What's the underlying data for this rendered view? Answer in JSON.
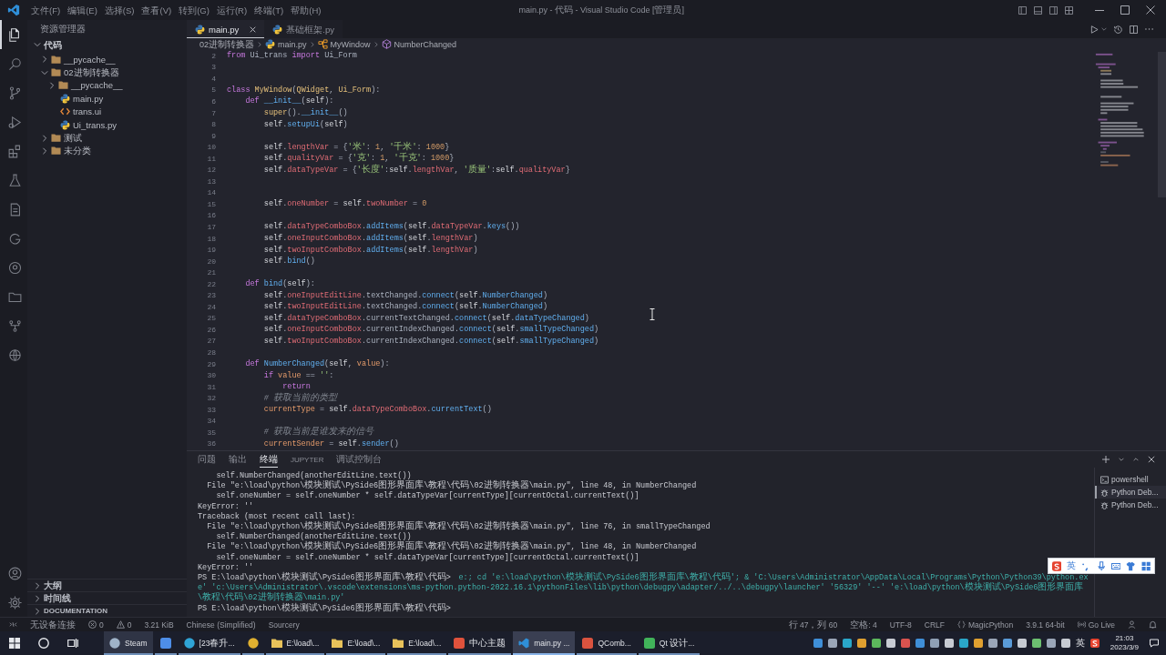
{
  "title_bar": {
    "menus": [
      "文件(F)",
      "编辑(E)",
      "选择(S)",
      "查看(V)",
      "转到(G)",
      "运行(R)",
      "终端(T)",
      "帮助(H)"
    ],
    "title": "main.py - 代码 - Visual Studio Code [管理员]"
  },
  "activity_bar": {
    "items": [
      {
        "kind": "files",
        "selected": true
      },
      {
        "kind": "search",
        "selected": false
      },
      {
        "kind": "scm",
        "selected": false
      },
      {
        "kind": "debug",
        "selected": false
      },
      {
        "kind": "extensions",
        "selected": false
      },
      {
        "kind": "testing",
        "selected": false
      },
      {
        "kind": "pages",
        "selected": false
      },
      {
        "kind": "ring",
        "selected": false
      },
      {
        "kind": "circle",
        "selected": false
      },
      {
        "kind": "folder",
        "selected": false
      },
      {
        "kind": "tree",
        "selected": false
      },
      {
        "kind": "globe",
        "selected": false
      }
    ],
    "bottom": [
      {
        "kind": "account"
      },
      {
        "kind": "settings"
      }
    ]
  },
  "sidebar": {
    "title": "资源管理器",
    "tree": [
      {
        "label": "代码",
        "kind": "root",
        "expanded": true,
        "children": [
          {
            "label": "__pycache__",
            "kind": "folder",
            "expanded": false
          },
          {
            "label": "02进制转换器",
            "kind": "folder",
            "expanded": true,
            "children": [
              {
                "label": "__pycache__",
                "kind": "folder",
                "expanded": false
              },
              {
                "label": "main.py",
                "kind": "python"
              },
              {
                "label": "trans.ui",
                "kind": "ui"
              },
              {
                "label": "Ui_trans.py",
                "kind": "python"
              }
            ]
          },
          {
            "label": "测试",
            "kind": "folder",
            "expanded": false
          },
          {
            "label": "未分类",
            "kind": "folder",
            "expanded": false
          }
        ]
      }
    ],
    "sections": [
      {
        "label": "大纲",
        "expanded": false
      },
      {
        "label": "时间线",
        "expanded": false
      },
      {
        "label": "DOCUMENTATION",
        "expanded": false
      }
    ]
  },
  "editor": {
    "tabs": [
      {
        "label": "main.py",
        "kind": "python",
        "selected": true
      },
      {
        "label": "基础框架.py",
        "kind": "python",
        "selected": false
      }
    ],
    "breadcrumb": [
      {
        "label": "02进制转换器",
        "kind": "folder"
      },
      {
        "label": "main.py",
        "kind": "python"
      },
      {
        "label": "MyWindow",
        "kind": "class"
      },
      {
        "label": "NumberChanged",
        "kind": "method"
      }
    ],
    "lines": [
      {
        "number": "2",
        "tokens": [
          {
            "kind": "kw",
            "text": "from"
          },
          {
            "kind": "txt",
            "text": " Ui_trans "
          },
          {
            "kind": "kw",
            "text": "import"
          },
          {
            "kind": "txt",
            "text": " Ui_Form"
          }
        ]
      },
      {
        "number": "3"
      },
      {
        "number": "4"
      },
      {
        "number": "5",
        "tokens": [
          {
            "kind": "kw",
            "text": "class "
          },
          {
            "kind": "cls",
            "text": "MyWindow"
          },
          {
            "kind": "txt",
            "text": "("
          },
          {
            "kind": "cls",
            "text": "QWidget"
          },
          {
            "kind": "txt",
            "text": ", "
          },
          {
            "kind": "cls",
            "text": "Ui_Form"
          },
          {
            "kind": "txt",
            "text": "):"
          }
        ],
        "children": [
          {
            "number": "6",
            "tokens": [
              {
                "kind": "kw",
                "text": "def "
              },
              {
                "kind": "fn",
                "text": "__init__"
              },
              {
                "kind": "txt",
                "text": "("
              },
              {
                "kind": "self",
                "text": "self"
              },
              {
                "kind": "txt",
                "text": "):"
              }
            ],
            "children": [
              {
                "number": "7",
                "tokens": [
                  {
                    "kind": "cls",
                    "text": "super"
                  },
                  {
                    "kind": "txt",
                    "text": "()."
                  },
                  {
                    "kind": "fn",
                    "text": "__init__"
                  },
                  {
                    "kind": "txt",
                    "text": "()"
                  }
                ]
              },
              {
                "number": "8",
                "tokens": [
                  {
                    "kind": "self",
                    "text": "self"
                  },
                  {
                    "kind": "txt",
                    "text": "."
                  },
                  {
                    "kind": "fn",
                    "text": "setupUi"
                  },
                  {
                    "kind": "txt",
                    "text": "("
                  },
                  {
                    "kind": "self",
                    "text": "self"
                  },
                  {
                    "kind": "txt",
                    "text": ")"
                  }
                ]
              },
              {
                "number": "9"
              },
              {
                "number": "10",
                "tokens": [
                  {
                    "kind": "self",
                    "text": "self"
                  },
                  {
                    "kind": "txt",
                    "text": "."
                  },
                  {
                    "kind": "attr",
                    "text": "lengthVar"
                  },
                  {
                    "kind": "txt",
                    "text": " = {"
                  },
                  {
                    "kind": "str",
                    "text": "'米'"
                  },
                  {
                    "kind": "txt",
                    "text": ": "
                  },
                  {
                    "kind": "num",
                    "text": "1"
                  },
                  {
                    "kind": "txt",
                    "text": ", "
                  },
                  {
                    "kind": "str",
                    "text": "'千米'"
                  },
                  {
                    "kind": "txt",
                    "text": ": "
                  },
                  {
                    "kind": "num",
                    "text": "1000"
                  },
                  {
                    "kind": "txt",
                    "text": "}"
                  }
                ]
              },
              {
                "number": "11",
                "tokens": [
                  {
                    "kind": "self",
                    "text": "self"
                  },
                  {
                    "kind": "txt",
                    "text": "."
                  },
                  {
                    "kind": "attr",
                    "text": "qualityVar"
                  },
                  {
                    "kind": "txt",
                    "text": " = {"
                  },
                  {
                    "kind": "str",
                    "text": "'克'"
                  },
                  {
                    "kind": "txt",
                    "text": ": "
                  },
                  {
                    "kind": "num",
                    "text": "1"
                  },
                  {
                    "kind": "txt",
                    "text": ", "
                  },
                  {
                    "kind": "str",
                    "text": "'千克'"
                  },
                  {
                    "kind": "txt",
                    "text": ": "
                  },
                  {
                    "kind": "num",
                    "text": "1000"
                  },
                  {
                    "kind": "txt",
                    "text": "}"
                  }
                ]
              },
              {
                "number": "12",
                "tokens": [
                  {
                    "kind": "self",
                    "text": "self"
                  },
                  {
                    "kind": "txt",
                    "text": "."
                  },
                  {
                    "kind": "attr",
                    "text": "dataTypeVar"
                  },
                  {
                    "kind": "txt",
                    "text": " = {"
                  },
                  {
                    "kind": "str",
                    "text": "'长度'"
                  },
                  {
                    "kind": "txt",
                    "text": ":"
                  },
                  {
                    "kind": "self",
                    "text": "self"
                  },
                  {
                    "kind": "txt",
                    "text": "."
                  },
                  {
                    "kind": "attr",
                    "text": "lengthVar"
                  },
                  {
                    "kind": "txt",
                    "text": ", "
                  },
                  {
                    "kind": "str",
                    "text": "'质量'"
                  },
                  {
                    "kind": "txt",
                    "text": ":"
                  },
                  {
                    "kind": "self",
                    "text": "self"
                  },
                  {
                    "kind": "txt",
                    "text": "."
                  },
                  {
                    "kind": "attr",
                    "text": "qualityVar"
                  },
                  {
                    "kind": "txt",
                    "text": "}"
                  }
                ]
              },
              {
                "number": "13"
              },
              {
                "number": "14"
              },
              {
                "number": "15",
                "tokens": [
                  {
                    "kind": "self",
                    "text": "self"
                  },
                  {
                    "kind": "txt",
                    "text": "."
                  },
                  {
                    "kind": "attr",
                    "text": "oneNumber"
                  },
                  {
                    "kind": "txt",
                    "text": " = "
                  },
                  {
                    "kind": "self",
                    "text": "self"
                  },
                  {
                    "kind": "txt",
                    "text": "."
                  },
                  {
                    "kind": "attr",
                    "text": "twoNumber"
                  },
                  {
                    "kind": "txt",
                    "text": " = "
                  },
                  {
                    "kind": "num",
                    "text": "0"
                  }
                ]
              },
              {
                "number": "16"
              },
              {
                "number": "17",
                "tokens": [
                  {
                    "kind": "self",
                    "text": "self"
                  },
                  {
                    "kind": "txt",
                    "text": "."
                  },
                  {
                    "kind": "attr",
                    "text": "dataTypeComboBox"
                  },
                  {
                    "kind": "txt",
                    "text": "."
                  },
                  {
                    "kind": "fn",
                    "text": "addItems"
                  },
                  {
                    "kind": "txt",
                    "text": "("
                  },
                  {
                    "kind": "self",
                    "text": "self"
                  },
                  {
                    "kind": "txt",
                    "text": "."
                  },
                  {
                    "kind": "attr",
                    "text": "dataTypeVar"
                  },
                  {
                    "kind": "txt",
                    "text": "."
                  },
                  {
                    "kind": "fn",
                    "text": "keys"
                  },
                  {
                    "kind": "txt",
                    "text": "())"
                  }
                ]
              },
              {
                "number": "18",
                "tokens": [
                  {
                    "kind": "self",
                    "text": "self"
                  },
                  {
                    "kind": "txt",
                    "text": "."
                  },
                  {
                    "kind": "attr",
                    "text": "oneInputComboBox"
                  },
                  {
                    "kind": "txt",
                    "text": "."
                  },
                  {
                    "kind": "fn",
                    "text": "addItems"
                  },
                  {
                    "kind": "txt",
                    "text": "("
                  },
                  {
                    "kind": "self",
                    "text": "self"
                  },
                  {
                    "kind": "txt",
                    "text": "."
                  },
                  {
                    "kind": "attr",
                    "text": "lengthVar"
                  },
                  {
                    "kind": "txt",
                    "text": ")"
                  }
                ]
              },
              {
                "number": "19",
                "tokens": [
                  {
                    "kind": "self",
                    "text": "self"
                  },
                  {
                    "kind": "txt",
                    "text": "."
                  },
                  {
                    "kind": "attr",
                    "text": "twoInputComboBox"
                  },
                  {
                    "kind": "txt",
                    "text": "."
                  },
                  {
                    "kind": "fn",
                    "text": "addItems"
                  },
                  {
                    "kind": "txt",
                    "text": "("
                  },
                  {
                    "kind": "self",
                    "text": "self"
                  },
                  {
                    "kind": "txt",
                    "text": "."
                  },
                  {
                    "kind": "attr",
                    "text": "lengthVar"
                  },
                  {
                    "kind": "txt",
                    "text": ")"
                  }
                ]
              },
              {
                "number": "20",
                "tokens": [
                  {
                    "kind": "self",
                    "text": "self"
                  },
                  {
                    "kind": "txt",
                    "text": "."
                  },
                  {
                    "kind": "fn",
                    "text": "bind"
                  },
                  {
                    "kind": "txt",
                    "text": "()"
                  }
                ]
              },
              {
                "number": "21"
              }
            ]
          },
          {
            "number": "22",
            "tokens": [
              {
                "kind": "kw",
                "text": "def "
              },
              {
                "kind": "fn",
                "text": "bind"
              },
              {
                "kind": "txt",
                "text": "("
              },
              {
                "kind": "self",
                "text": "self"
              },
              {
                "kind": "txt",
                "text": "):"
              }
            ],
            "children": [
              {
                "number": "23",
                "tokens": [
                  {
                    "kind": "self",
                    "text": "self"
                  },
                  {
                    "kind": "txt",
                    "text": "."
                  },
                  {
                    "kind": "attr",
                    "text": "oneInputEditLine"
                  },
                  {
                    "kind": "txt",
                    "text": ".textChanged."
                  },
                  {
                    "kind": "fn",
                    "text": "connect"
                  },
                  {
                    "kind": "txt",
                    "text": "("
                  },
                  {
                    "kind": "self",
                    "text": "self"
                  },
                  {
                    "kind": "txt",
                    "text": "."
                  },
                  {
                    "kind": "fn",
                    "text": "NumberChanged"
                  },
                  {
                    "kind": "txt",
                    "text": ")"
                  }
                ]
              },
              {
                "number": "24",
                "tokens": [
                  {
                    "kind": "self",
                    "text": "self"
                  },
                  {
                    "kind": "txt",
                    "text": "."
                  },
                  {
                    "kind": "attr",
                    "text": "twoInputEditLine"
                  },
                  {
                    "kind": "txt",
                    "text": ".textChanged."
                  },
                  {
                    "kind": "fn",
                    "text": "connect"
                  },
                  {
                    "kind": "txt",
                    "text": "("
                  },
                  {
                    "kind": "self",
                    "text": "self"
                  },
                  {
                    "kind": "txt",
                    "text": "."
                  },
                  {
                    "kind": "fn",
                    "text": "NumberChanged"
                  },
                  {
                    "kind": "txt",
                    "text": ")"
                  }
                ]
              },
              {
                "number": "25",
                "tokens": [
                  {
                    "kind": "self",
                    "text": "self"
                  },
                  {
                    "kind": "txt",
                    "text": "."
                  },
                  {
                    "kind": "attr",
                    "text": "dataTypeComboBox"
                  },
                  {
                    "kind": "txt",
                    "text": ".currentTextChanged."
                  },
                  {
                    "kind": "fn",
                    "text": "connect"
                  },
                  {
                    "kind": "txt",
                    "text": "("
                  },
                  {
                    "kind": "self",
                    "text": "self"
                  },
                  {
                    "kind": "txt",
                    "text": "."
                  },
                  {
                    "kind": "fn",
                    "text": "dataTypeChanged"
                  },
                  {
                    "kind": "txt",
                    "text": ")"
                  }
                ]
              },
              {
                "number": "26",
                "tokens": [
                  {
                    "kind": "self",
                    "text": "self"
                  },
                  {
                    "kind": "txt",
                    "text": "."
                  },
                  {
                    "kind": "attr",
                    "text": "oneInputComboBox"
                  },
                  {
                    "kind": "txt",
                    "text": ".currentIndexChanged."
                  },
                  {
                    "kind": "fn",
                    "text": "connect"
                  },
                  {
                    "kind": "txt",
                    "text": "("
                  },
                  {
                    "kind": "self",
                    "text": "self"
                  },
                  {
                    "kind": "txt",
                    "text": "."
                  },
                  {
                    "kind": "fn",
                    "text": "smallTypeChanged"
                  },
                  {
                    "kind": "txt",
                    "text": ")"
                  }
                ]
              },
              {
                "number": "27",
                "tokens": [
                  {
                    "kind": "self",
                    "text": "self"
                  },
                  {
                    "kind": "txt",
                    "text": "."
                  },
                  {
                    "kind": "attr",
                    "text": "twoInputComboBox"
                  },
                  {
                    "kind": "txt",
                    "text": ".currentIndexChanged."
                  },
                  {
                    "kind": "fn",
                    "text": "connect"
                  },
                  {
                    "kind": "txt",
                    "text": "("
                  },
                  {
                    "kind": "self",
                    "text": "self"
                  },
                  {
                    "kind": "txt",
                    "text": "."
                  },
                  {
                    "kind": "fn",
                    "text": "smallTypeChanged"
                  },
                  {
                    "kind": "txt",
                    "text": ")"
                  }
                ]
              },
              {
                "number": "28"
              }
            ]
          },
          {
            "number": "29",
            "tokens": [
              {
                "kind": "kw",
                "text": "def "
              },
              {
                "kind": "fn",
                "text": "NumberChanged"
              },
              {
                "kind": "txt",
                "text": "("
              },
              {
                "kind": "self",
                "text": "self"
              },
              {
                "kind": "txt",
                "text": ", "
              },
              {
                "kind": "var",
                "text": "value"
              },
              {
                "kind": "txt",
                "text": "):"
              }
            ],
            "children": [
              {
                "number": "30",
                "tokens": [
                  {
                    "kind": "kw",
                    "text": "if "
                  },
                  {
                    "kind": "var",
                    "text": "value"
                  },
                  {
                    "kind": "txt",
                    "text": " == "
                  },
                  {
                    "kind": "str",
                    "text": "''"
                  },
                  {
                    "kind": "txt",
                    "text": ":"
                  }
                ],
                "children": [
                  {
                    "number": "31",
                    "tokens": [
                      {
                        "kind": "kw",
                        "text": "return"
                      }
                    ]
                  }
                ]
              },
              {
                "number": "32",
                "tokens": [
                  {
                    "kind": "cmt",
                    "text": "# 获取当前的类型"
                  }
                ]
              },
              {
                "number": "33",
                "tokens": [
                  {
                    "kind": "var",
                    "text": "currentType"
                  },
                  {
                    "kind": "txt",
                    "text": " = "
                  },
                  {
                    "kind": "self",
                    "text": "self"
                  },
                  {
                    "kind": "txt",
                    "text": "."
                  },
                  {
                    "kind": "attr",
                    "text": "dataTypeComboBox"
                  },
                  {
                    "kind": "txt",
                    "text": "."
                  },
                  {
                    "kind": "fn",
                    "text": "currentText"
                  },
                  {
                    "kind": "txt",
                    "text": "()"
                  }
                ]
              },
              {
                "number": "34"
              },
              {
                "number": "35",
                "tokens": [
                  {
                    "kind": "cmt",
                    "text": "# 获取当前是谁发来的信号"
                  }
                ]
              },
              {
                "number": "36",
                "tokens": [
                  {
                    "kind": "var",
                    "text": "currentSender"
                  },
                  {
                    "kind": "txt",
                    "text": " = "
                  },
                  {
                    "kind": "self",
                    "text": "self"
                  },
                  {
                    "kind": "txt",
                    "text": "."
                  },
                  {
                    "kind": "fn",
                    "text": "sender"
                  },
                  {
                    "kind": "txt",
                    "text": "()"
                  }
                ]
              }
            ]
          }
        ]
      }
    ]
  },
  "panel": {
    "tabs": [
      {
        "label": "问题",
        "selected": false
      },
      {
        "label": "输出",
        "selected": false
      },
      {
        "label": "终端",
        "selected": true
      },
      {
        "label": "JUPYTER",
        "selected": false
      },
      {
        "label": "调试控制台",
        "selected": false
      }
    ],
    "terminal_lines": [
      {
        "parts": [
          {
            "kind": "out",
            "text": "    self.NumberChanged(anotherEditLine.text())"
          }
        ]
      },
      {
        "parts": [
          {
            "kind": "out",
            "text": "  File \"e:\\load\\python\\模块测试\\PySide6图形界面库\\教程\\代码\\02进制转换器\\main.py\", line 48, in NumberChanged"
          }
        ]
      },
      {
        "parts": [
          {
            "kind": "out",
            "text": "    self.oneNumber = self.oneNumber * self.dataTypeVar[currentType][currentOctal.currentText()]"
          }
        ]
      },
      {
        "parts": [
          {
            "kind": "out",
            "text": "KeyError: ''"
          }
        ]
      },
      {
        "parts": [
          {
            "kind": "out",
            "text": "Traceback (most recent call last):"
          }
        ]
      },
      {
        "parts": [
          {
            "kind": "out",
            "text": "  File \"e:\\load\\python\\模块测试\\PySide6图形界面库\\教程\\代码\\02进制转换器\\main.py\", line 76, in smallTypeChanged"
          }
        ]
      },
      {
        "parts": [
          {
            "kind": "out",
            "text": "    self.NumberChanged(anotherEditLine.text())"
          }
        ]
      },
      {
        "parts": [
          {
            "kind": "out",
            "text": "  File \"e:\\load\\python\\模块测试\\PySide6图形界面库\\教程\\代码\\02进制转换器\\main.py\", line 48, in NumberChanged"
          }
        ]
      },
      {
        "parts": [
          {
            "kind": "out",
            "text": "    self.oneNumber = self.oneNumber * self.dataTypeVar[currentType][currentOctal.currentText()]"
          }
        ]
      },
      {
        "parts": [
          {
            "kind": "out",
            "text": "KeyError: ''"
          }
        ]
      },
      {
        "parts": [
          {
            "kind": "prompt",
            "text": "PS E:\\load\\python\\模块测试\\PySide6图形界面库\\教程\\代码>"
          },
          {
            "kind": "command",
            "text": "e:; cd 'e:\\load\\python\\模块测试\\PySide6图形界面库\\教程\\代码'; & 'C:\\Users\\Administrator\\AppData\\Local\\Programs\\Python\\Python39\\python.exe' 'c:\\Users\\Administrator\\.vscode\\extensions\\ms-python.python-2022.16.1\\pythonFiles\\lib\\python\\debugpy\\adapter/../..\\debugpy\\launcher' '56329' '--' 'e:\\load\\python\\模块测试\\PySide6图形界面库\\教程\\代码\\02进制转换器\\main.py'"
          }
        ]
      },
      {
        "parts": [
          {
            "kind": "prompt",
            "text": "PS E:\\load\\python\\模块测试\\PySide6图形界面库\\教程\\代码>"
          }
        ]
      }
    ],
    "terminals": [
      {
        "label": "powershell",
        "kind": "shell",
        "selected": false
      },
      {
        "label": "Python Deb...",
        "kind": "debug",
        "selected": true
      },
      {
        "label": "Python Deb...",
        "kind": "debug",
        "selected": false
      }
    ]
  },
  "status_bar": {
    "left": [
      {
        "kind": "remote"
      },
      {
        "kind": "text",
        "text": "无设备连接"
      },
      {
        "kind": "errors",
        "text": "0"
      },
      {
        "kind": "warnings",
        "text": "0"
      },
      {
        "kind": "text",
        "text": "3.21 KiB"
      },
      {
        "kind": "text",
        "text": "Chinese (Simplified)"
      },
      {
        "kind": "text",
        "text": "Sourcery"
      }
    ],
    "right": [
      {
        "kind": "text",
        "text": "行 47，列 60"
      },
      {
        "kind": "text",
        "text": "空格: 4"
      },
      {
        "kind": "text",
        "text": "UTF-8"
      },
      {
        "kind": "text",
        "text": "CRLF"
      },
      {
        "kind": "language",
        "text": "MagicPython"
      },
      {
        "kind": "text",
        "text": "3.9.1 64-bit"
      },
      {
        "kind": "live",
        "text": "Go Live"
      },
      {
        "kind": "feedback"
      },
      {
        "kind": "bell"
      }
    ]
  },
  "ime_toolbar": {
    "mode": "英"
  },
  "taskbar": {
    "apps": [
      {
        "kind": "steam",
        "label": "Steam",
        "selected": false,
        "hovered": true
      },
      {
        "kind": "bird",
        "selected": false,
        "hovered": false
      },
      {
        "kind": "edge",
        "label": "[23春升...",
        "selected": false,
        "hovered": false
      },
      {
        "kind": "chrome",
        "selected": false,
        "hovered": false
      },
      {
        "kind": "folder",
        "label": "E:\\load\\...",
        "selected": false,
        "hovered": false
      },
      {
        "kind": "folder",
        "label": "E:\\load\\...",
        "selected": false,
        "hovered": false
      },
      {
        "kind": "folder",
        "label": "E:\\load\\...",
        "selected": false,
        "hovered": false
      },
      {
        "kind": "red",
        "label": "中心主题",
        "selected": false,
        "hovered": false
      },
      {
        "kind": "vscode",
        "label": "main.py ...",
        "selected": true,
        "hovered": false
      },
      {
        "kind": "qt-red",
        "label": "QComb...",
        "selected": false,
        "hovered": false
      },
      {
        "kind": "qt",
        "label": "Qt 设计...",
        "selected": false,
        "hovered": false
      }
    ],
    "tray": {
      "ime": "英",
      "time": "21:03",
      "date": "2023/3/9"
    }
  }
}
